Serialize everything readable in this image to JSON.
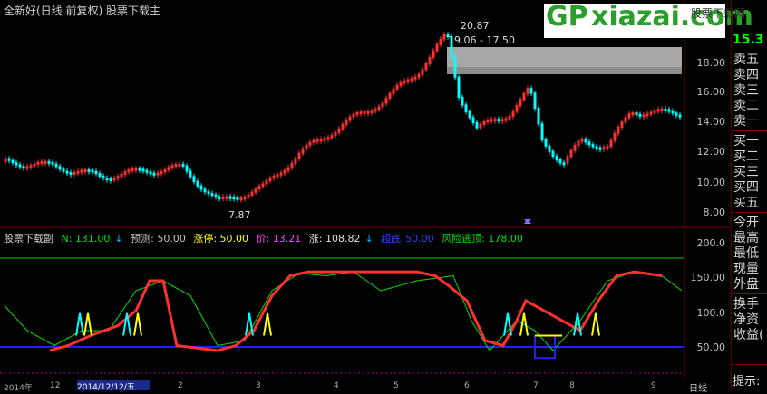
{
  "title": "全新好(日线 前复权) 股票下载主",
  "logo": {
    "brand_gp": "GP",
    "brand_x": "xiazai",
    "brand_com": ".com",
    "sub": "股票下载网",
    "url": ""
  },
  "top_price": "15.3",
  "annotations": {
    "high": "20.87",
    "range": "19.06 - 17.50",
    "low": "7.87"
  },
  "price_axis": [
    "18.00",
    "16.00",
    "14.00",
    "12.00",
    "10.00",
    "8.00"
  ],
  "indicator_axis": [
    "200.0",
    "150.00",
    "100.0",
    "50.00"
  ],
  "indicator": {
    "name": "股票下载副",
    "items": [
      {
        "label": "N: 131.00",
        "color": "#00e000"
      },
      {
        "label": "↓",
        "color": "#00bfff"
      },
      {
        "label": "预测: 50.00",
        "color": "#c0c0c0"
      },
      {
        "label": "涨停: 50.00",
        "color": "#ffff00"
      },
      {
        "label": "价: 13.21",
        "color": "#ff44ff"
      },
      {
        "label": "涨: 108.82",
        "color": "#e0e0e0"
      },
      {
        "label": "↓",
        "color": "#00bfff"
      },
      {
        "label": "超底",
        "color": "#3344ff"
      },
      {
        "label": "50.00",
        "color": "#3344ff"
      },
      {
        "label": "风险逃顶: 178.00",
        "color": "#00e000"
      }
    ]
  },
  "side_panel": [
    "卖五",
    "卖四",
    "卖三",
    "卖二",
    "卖一",
    "买一",
    "买二",
    "买三",
    "买四",
    "买五",
    "今开",
    "最高",
    "最低",
    "现量",
    "外盘",
    "换手",
    "净资",
    "收益(",
    "提示:"
  ],
  "dates": [
    "2014年",
    "12",
    "2014/12/12/五",
    "2",
    "3",
    "4",
    "5",
    "6",
    "7",
    "8",
    "9",
    "日线"
  ],
  "colors": {
    "up": "#ff3030",
    "down": "#00ffff",
    "green": "#00e000",
    "blue": "#2020ff",
    "yellow": "#ffff00"
  }
}
